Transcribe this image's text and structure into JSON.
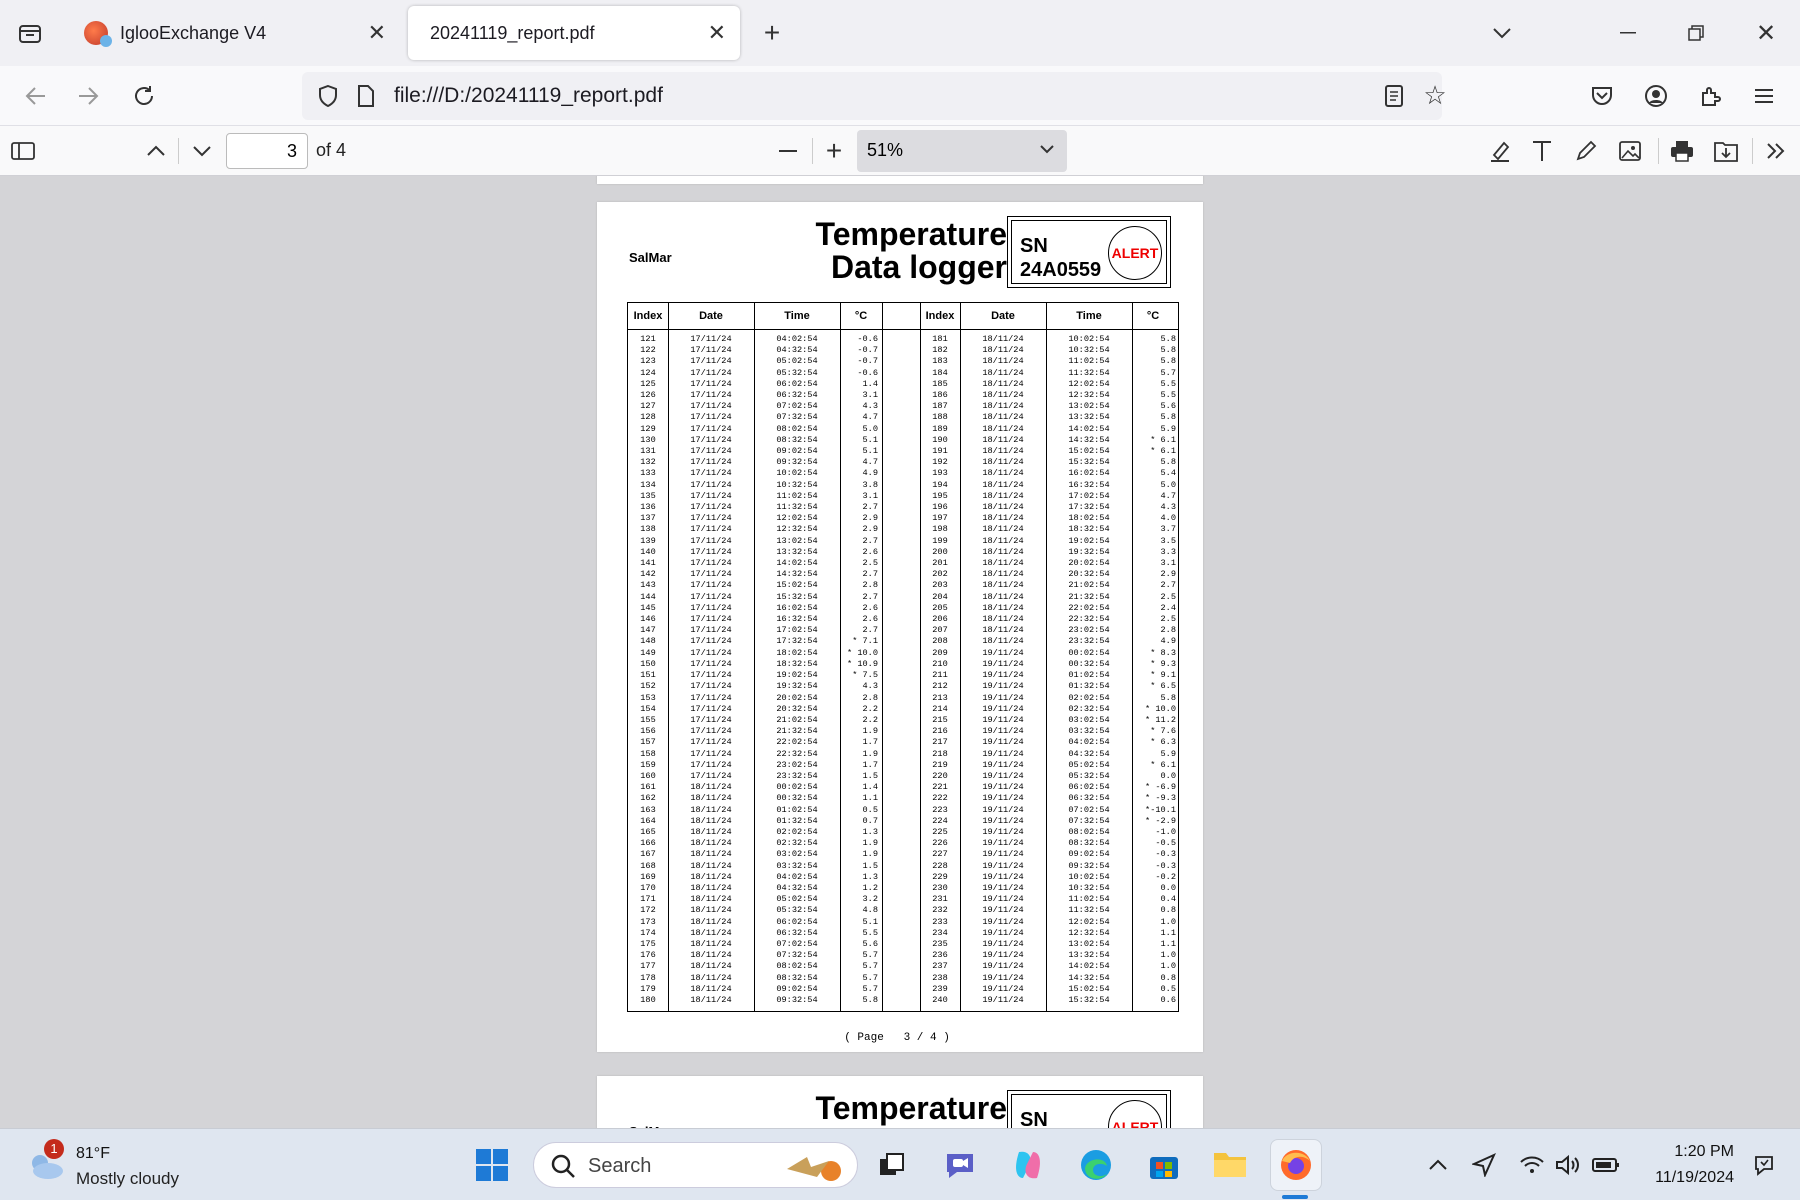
{
  "browser": {
    "tabs": [
      {
        "title": "IglooExchange V4",
        "active": false
      },
      {
        "title": "20241119_report.pdf",
        "active": true
      }
    ],
    "url": "file:///D:/20241119_report.pdf"
  },
  "pdf_toolbar": {
    "page_current": "3",
    "page_count": "of 4",
    "zoom": "51%"
  },
  "document": {
    "company": "SalMar",
    "title_line1": "Temperature",
    "title_line2": "Data logger",
    "sn_label": "SN",
    "sn_value": "24A0559",
    "alert_label": "ALERT",
    "headers": [
      "Index",
      "Date",
      "Time",
      "°C",
      "Index",
      "Date",
      "Time",
      "°C"
    ],
    "left": {
      "index": "121\n122\n123\n124\n125\n126\n127\n128\n129\n130\n131\n132\n133\n134\n135\n136\n137\n138\n139\n140\n141\n142\n143\n144\n145\n146\n147\n148\n149\n150\n151\n152\n153\n154\n155\n156\n157\n158\n159\n160\n161\n162\n163\n164\n165\n166\n167\n168\n169\n170\n171\n172\n173\n174\n175\n176\n177\n178\n179\n180",
      "date": "17/11/24\n17/11/24\n17/11/24\n17/11/24\n17/11/24\n17/11/24\n17/11/24\n17/11/24\n17/11/24\n17/11/24\n17/11/24\n17/11/24\n17/11/24\n17/11/24\n17/11/24\n17/11/24\n17/11/24\n17/11/24\n17/11/24\n17/11/24\n17/11/24\n17/11/24\n17/11/24\n17/11/24\n17/11/24\n17/11/24\n17/11/24\n17/11/24\n17/11/24\n17/11/24\n17/11/24\n17/11/24\n17/11/24\n17/11/24\n17/11/24\n17/11/24\n17/11/24\n17/11/24\n17/11/24\n17/11/24\n18/11/24\n18/11/24\n18/11/24\n18/11/24\n18/11/24\n18/11/24\n18/11/24\n18/11/24\n18/11/24\n18/11/24\n18/11/24\n18/11/24\n18/11/24\n18/11/24\n18/11/24\n18/11/24\n18/11/24\n18/11/24\n18/11/24\n18/11/24",
      "time": "04:02:54\n04:32:54\n05:02:54\n05:32:54\n06:02:54\n06:32:54\n07:02:54\n07:32:54\n08:02:54\n08:32:54\n09:02:54\n09:32:54\n10:02:54\n10:32:54\n11:02:54\n11:32:54\n12:02:54\n12:32:54\n13:02:54\n13:32:54\n14:02:54\n14:32:54\n15:02:54\n15:32:54\n16:02:54\n16:32:54\n17:02:54\n17:32:54\n18:02:54\n18:32:54\n19:02:54\n19:32:54\n20:02:54\n20:32:54\n21:02:54\n21:32:54\n22:02:54\n22:32:54\n23:02:54\n23:32:54\n00:02:54\n00:32:54\n01:02:54\n01:32:54\n02:02:54\n02:32:54\n03:02:54\n03:32:54\n04:02:54\n04:32:54\n05:02:54\n05:32:54\n06:02:54\n06:32:54\n07:02:54\n07:32:54\n08:02:54\n08:32:54\n09:02:54\n09:32:54",
      "temp": "-0.6\n-0.7\n-0.7\n-0.6\n1.4\n3.1\n4.3\n4.7\n5.0\n5.1\n5.1\n4.7\n4.9\n3.8\n3.1\n2.7\n2.9\n2.9\n2.7\n2.6\n2.5\n2.7\n2.8\n2.7\n2.6\n2.6\n2.7\n* 7.1\n* 10.0\n* 10.9\n* 7.5\n4.3\n2.8\n2.2\n2.2\n1.9\n1.7\n1.9\n1.7\n1.5\n1.4\n1.1\n0.5\n0.7\n1.3\n1.9\n1.9\n1.5\n1.3\n1.2\n3.2\n4.8\n5.1\n5.5\n5.6\n5.7\n5.7\n5.7\n5.7\n5.8"
    },
    "right": {
      "index": "181\n182\n183\n184\n185\n186\n187\n188\n189\n190\n191\n192\n193\n194\n195\n196\n197\n198\n199\n200\n201\n202\n203\n204\n205\n206\n207\n208\n209\n210\n211\n212\n213\n214\n215\n216\n217\n218\n219\n220\n221\n222\n223\n224\n225\n226\n227\n228\n229\n230\n231\n232\n233\n234\n235\n236\n237\n238\n239\n240",
      "date": "18/11/24\n18/11/24\n18/11/24\n18/11/24\n18/11/24\n18/11/24\n18/11/24\n18/11/24\n18/11/24\n18/11/24\n18/11/24\n18/11/24\n18/11/24\n18/11/24\n18/11/24\n18/11/24\n18/11/24\n18/11/24\n18/11/24\n18/11/24\n18/11/24\n18/11/24\n18/11/24\n18/11/24\n18/11/24\n18/11/24\n18/11/24\n18/11/24\n19/11/24\n19/11/24\n19/11/24\n19/11/24\n19/11/24\n19/11/24\n19/11/24\n19/11/24\n19/11/24\n19/11/24\n19/11/24\n19/11/24\n19/11/24\n19/11/24\n19/11/24\n19/11/24\n19/11/24\n19/11/24\n19/11/24\n19/11/24\n19/11/24\n19/11/24\n19/11/24\n19/11/24\n19/11/24\n19/11/24\n19/11/24\n19/11/24\n19/11/24\n19/11/24\n19/11/24\n19/11/24",
      "time": "10:02:54\n10:32:54\n11:02:54\n11:32:54\n12:02:54\n12:32:54\n13:02:54\n13:32:54\n14:02:54\n14:32:54\n15:02:54\n15:32:54\n16:02:54\n16:32:54\n17:02:54\n17:32:54\n18:02:54\n18:32:54\n19:02:54\n19:32:54\n20:02:54\n20:32:54\n21:02:54\n21:32:54\n22:02:54\n22:32:54\n23:02:54\n23:32:54\n00:02:54\n00:32:54\n01:02:54\n01:32:54\n02:02:54\n02:32:54\n03:02:54\n03:32:54\n04:02:54\n04:32:54\n05:02:54\n05:32:54\n06:02:54\n06:32:54\n07:02:54\n07:32:54\n08:02:54\n08:32:54\n09:02:54\n09:32:54\n10:02:54\n10:32:54\n11:02:54\n11:32:54\n12:02:54\n12:32:54\n13:02:54\n13:32:54\n14:02:54\n14:32:54\n15:02:54\n15:32:54",
      "temp": "5.8\n5.8\n5.8\n5.7\n5.5\n5.5\n5.6\n5.8\n5.9\n* 6.1\n* 6.1\n5.8\n5.4\n5.0\n4.7\n4.3\n4.0\n3.7\n3.5\n3.3\n3.1\n2.9\n2.7\n2.5\n2.4\n2.5\n2.8\n4.9\n* 8.3\n* 9.3\n* 9.1\n* 6.5\n5.8\n* 10.0\n* 11.2\n* 7.6\n* 6.3\n5.9\n* 6.1\n0.0\n* -6.9\n* -9.3\n*-10.1\n* -2.9\n-1.0\n-0.5\n-0.3\n-0.3\n-0.2\n0.0\n0.4\n0.8\n1.0\n1.1\n1.1\n1.0\n1.0\n0.8\n0.5\n0.6"
    },
    "page_footer": "( Page   3 / 4 )"
  },
  "taskbar": {
    "weather_temp": "81°F",
    "weather_desc": "Mostly cloudy",
    "weather_badge": "1",
    "search_placeholder": "Search",
    "time": "1:20 PM",
    "date": "11/19/2024"
  }
}
